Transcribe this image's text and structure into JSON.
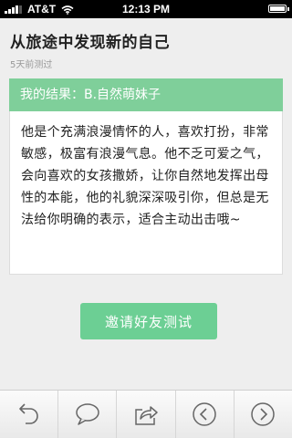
{
  "status_bar": {
    "carrier": "AT&T",
    "time": "12:13 PM",
    "signal_bars": 4,
    "signal_max": 5,
    "wifi_icon": "wifi-icon",
    "battery_level": 1.0
  },
  "page": {
    "title": "从旅途中发现新的自己",
    "meta": "5天前测过"
  },
  "result": {
    "header": "我的结果：B.自然萌妹子",
    "body": "他是个充满浪漫情怀的人，喜欢打扮，非常敏感，极富有浪漫气息。他不乏可爱之气，会向喜欢的女孩撒娇，让你自然地发挥出母性的本能，他的礼貌深深吸引你，但总是无法给你明确的表示，适合主动出击哦~"
  },
  "invite_button": {
    "label": "邀请好友测试"
  },
  "toolbar": {
    "items": [
      {
        "icon": "undo-icon"
      },
      {
        "icon": "comment-icon"
      },
      {
        "icon": "share-icon"
      },
      {
        "icon": "back-icon"
      },
      {
        "icon": "forward-icon"
      }
    ]
  },
  "colors": {
    "accent_green": "#7fcf9a",
    "button_green": "#6ccf94",
    "background": "#eeeeee"
  }
}
